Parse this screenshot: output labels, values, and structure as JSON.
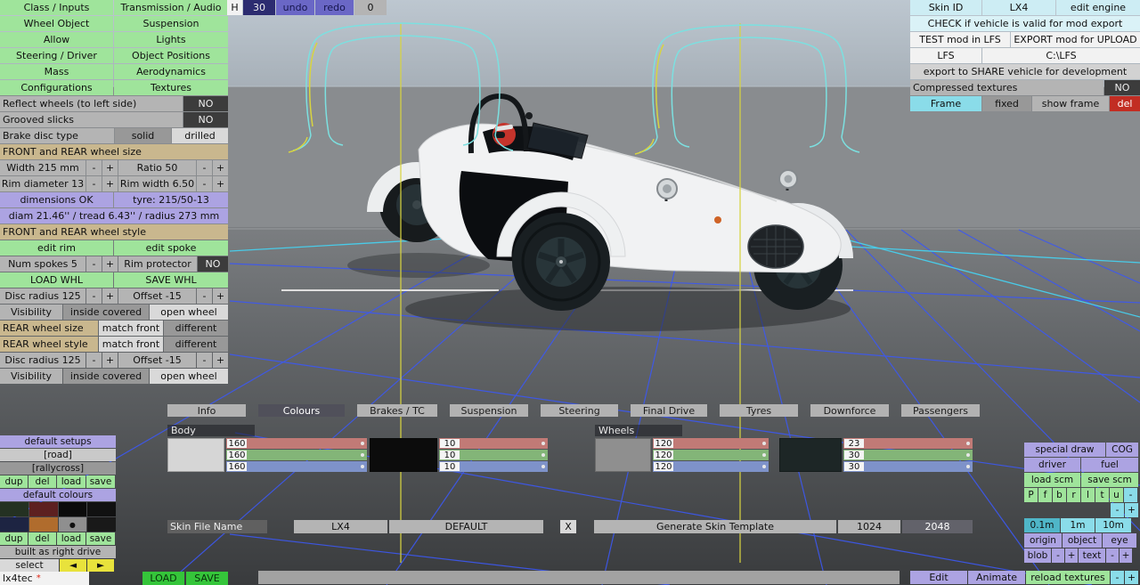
{
  "palette": {
    "green": "#9fe49b",
    "bright_green": "#35c53a",
    "gray": "#b4b4b4",
    "gray_selected": "#d9d9d9",
    "gray_dim": "#989898",
    "dark_value": "#3c3c3c",
    "tan": "#c9b78e",
    "lavender": "#aca3e2",
    "cyan": "#8adce9",
    "pale_cyan": "#cdedf4",
    "red": "#c22d23",
    "navy": "#2c2c70",
    "slate": "#6a67c6",
    "yellow": "#e8e23c"
  },
  "menu": {
    "items": [
      "Class / Inputs",
      "Transmission / Audio",
      "Wheel Object",
      "Suspension",
      "Allow",
      "Lights",
      "Steering / Driver",
      "Object Positions",
      "Mass",
      "Aerodynamics",
      "Configurations",
      "Textures"
    ]
  },
  "viewbar": {
    "h": "H",
    "steps": "30",
    "undo": "undo",
    "redo": "redo",
    "zero": "0"
  },
  "wheel": {
    "reflect": "Reflect wheels (to left side)",
    "reflect_val": "NO",
    "grooved": "Grooved slicks",
    "grooved_val": "NO",
    "brake": "Brake disc type",
    "solid": "solid",
    "drilled": "drilled",
    "size_header": "FRONT and REAR wheel size",
    "width": "Width 215 mm",
    "ratio": "Ratio 50",
    "rim_diameter": "Rim diameter 13",
    "rim_width": "Rim width 6.50",
    "dimensions": "dimensions OK",
    "tyre": "tyre: 215/50-13",
    "diam": "diam 21.46'' / tread 6.43'' / radius 273 mm",
    "style_header": "FRONT and REAR wheel style",
    "edit_rim": "edit rim",
    "edit_spoke": "edit spoke",
    "num_spokes": "Num spokes 5",
    "rim_protector": "Rim protector",
    "rim_protector_val": "NO",
    "load_whl": "LOAD WHL",
    "save_whl": "SAVE WHL",
    "disc_radius": "Disc radius 125",
    "offset": "Offset -15",
    "visibility": "Visibility",
    "inside_covered": "inside covered",
    "open_wheel": "open wheel",
    "rear_size": "REAR wheel size",
    "rear_style": "REAR wheel style",
    "match_front": "match front",
    "different": "different",
    "minus": "-",
    "plus": "+"
  },
  "export_panel": {
    "skin_id": "Skin ID",
    "skin_id_val": "LX4",
    "edit_engine": "edit engine",
    "check": "CHECK if vehicle is valid for mod export",
    "test": "TEST mod in LFS",
    "export_upload": "EXPORT mod for UPLOAD",
    "lfs": "LFS",
    "lfs_path": "C:\\LFS",
    "share": "export to SHARE vehicle for development",
    "compressed": "Compressed textures",
    "compressed_val": "NO",
    "frame": "Frame",
    "fixed": "fixed",
    "show_frame": "show frame",
    "del": "del"
  },
  "setups": {
    "title": "default setups",
    "items": [
      "[road]",
      "[rallycross]"
    ],
    "actions": [
      "dup",
      "del",
      "load",
      "save"
    ],
    "colours_title": "default colours",
    "swatches": [
      "#243122",
      "#5d2020",
      "#0b0b0b",
      "#111111",
      "#1d2442",
      "#b06c2d",
      "#8f8f8f",
      "#191919"
    ],
    "swatch_dot": "●",
    "built": "built as right drive",
    "select": "select",
    "prev": "◄",
    "next": "►",
    "vehicle": "lx4tec",
    "modified": "*",
    "load": "LOAD",
    "save": "SAVE"
  },
  "tabs": {
    "items": [
      "Info",
      "Colours",
      "Brakes / TC",
      "Suspension",
      "Steering",
      "Final Drive",
      "Tyres",
      "Downforce",
      "Passengers"
    ],
    "selected": "Colours"
  },
  "colours": {
    "body_label": "Body",
    "wheels_label": "Wheels",
    "groups": [
      {
        "swatch": "#d6d6d6",
        "r": "160",
        "g": "160",
        "b": "160"
      },
      {
        "swatch": "#0c0c0c",
        "r": "10",
        "g": "10",
        "b": "10"
      },
      {
        "swatch": "#8f8f8f",
        "r": "120",
        "g": "120",
        "b": "120"
      },
      {
        "swatch": "#1d2626",
        "r": "23",
        "g": "30",
        "b": "30"
      }
    ]
  },
  "skin": {
    "label": "Skin File Name",
    "car": "LX4",
    "file": "DEFAULT",
    "clear": "X",
    "generate": "Generate Skin Template",
    "res_small": "1024",
    "res_large": "2048"
  },
  "tools": {
    "special_draw": "special draw",
    "cog": "COG",
    "driver": "driver",
    "fuel": "fuel",
    "load_scm": "load scm",
    "save_scm": "save scm",
    "views": [
      "P",
      "f",
      "b",
      "r",
      "l",
      "t",
      "u"
    ],
    "grids": [
      "0.1m",
      "1m",
      "10m"
    ],
    "centres": [
      "origin",
      "object",
      "eye"
    ],
    "blob": "blob",
    "text": "text",
    "minus": "-",
    "plus": "+",
    "edit": "Edit",
    "animate": "Animate",
    "reload": "reload textures"
  }
}
